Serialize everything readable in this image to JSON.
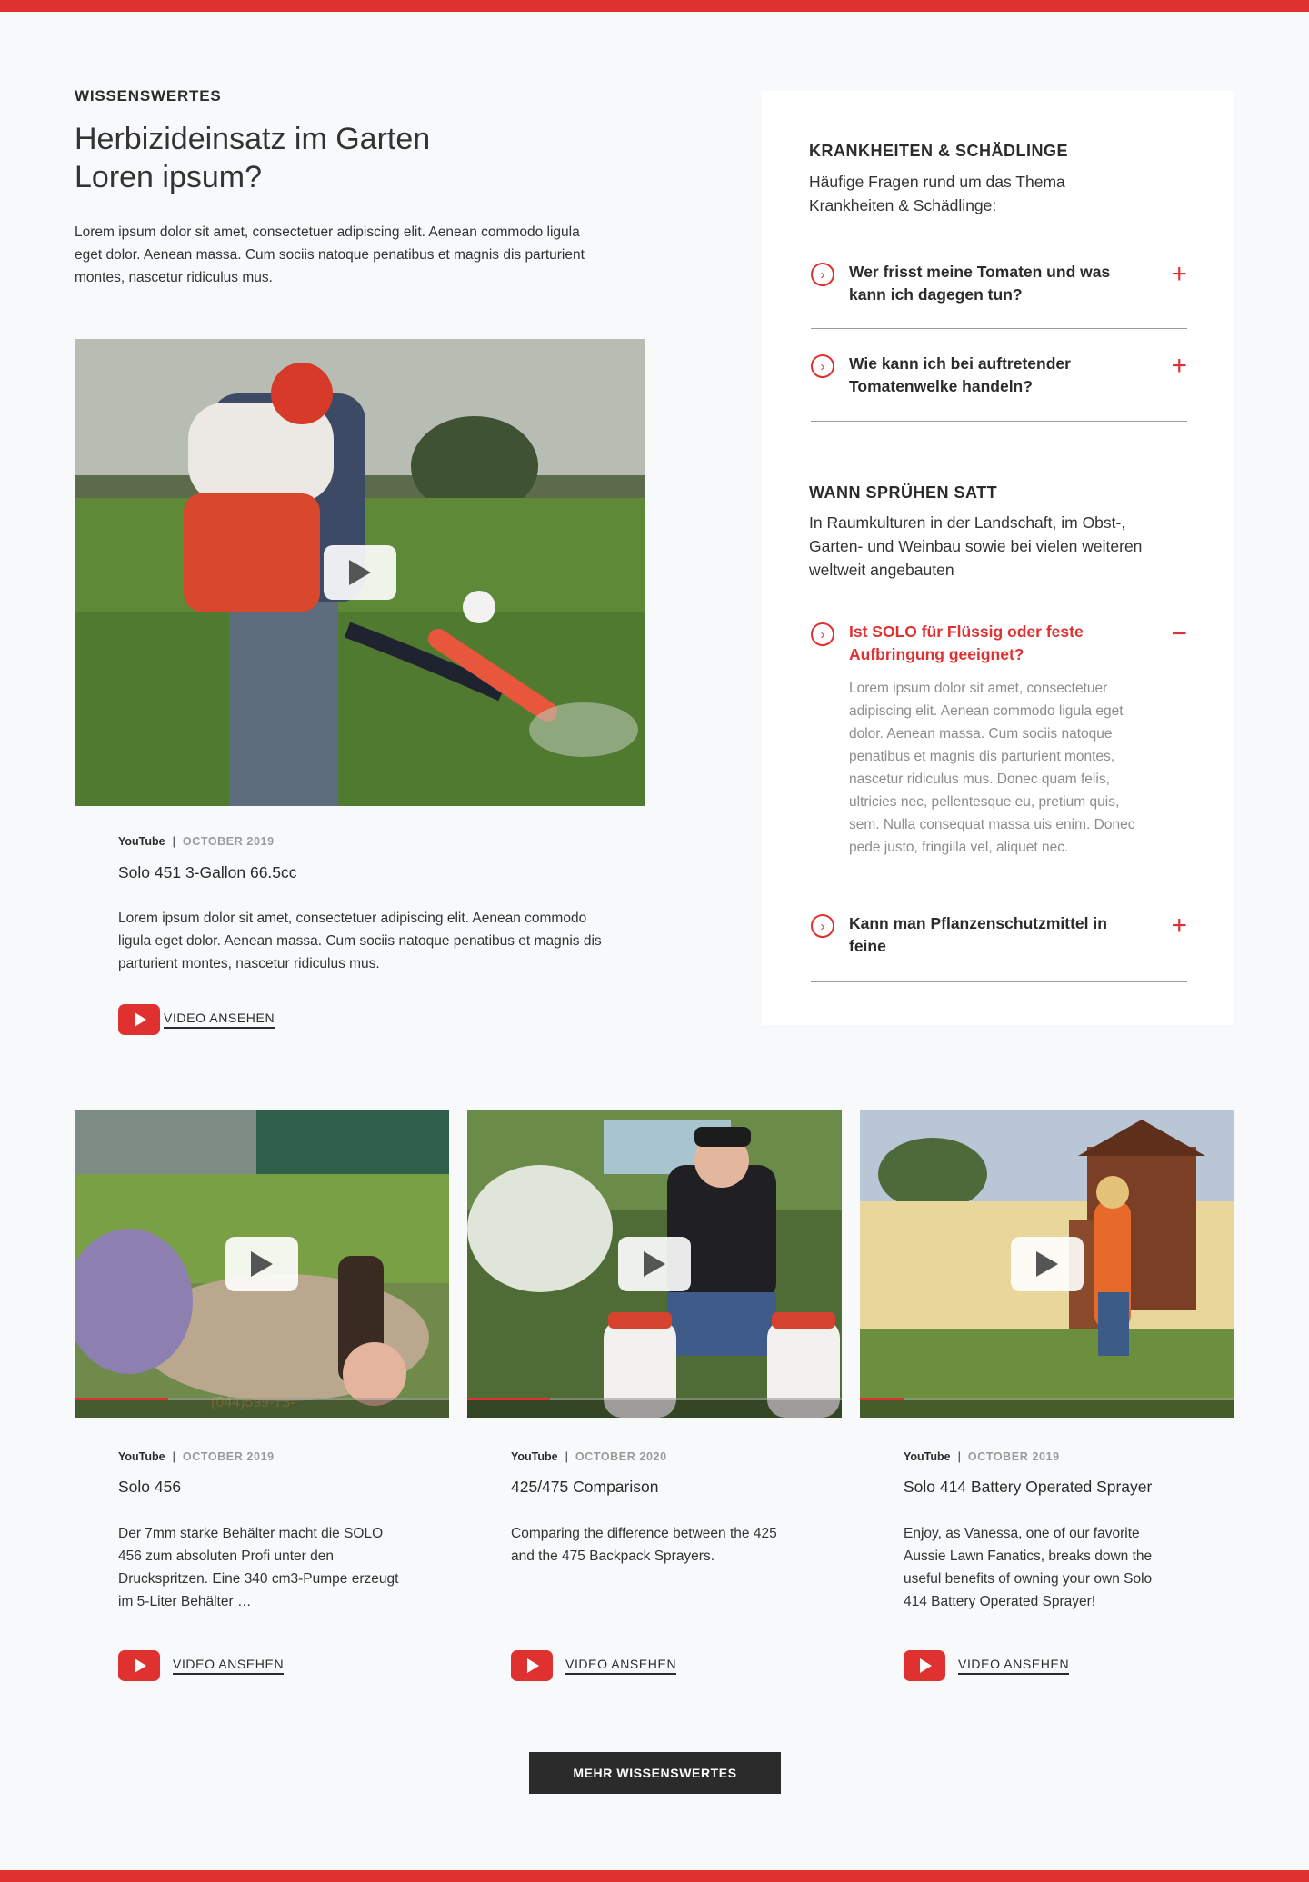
{
  "section": {
    "eyebrow": "WISSENSWERTES",
    "headline_line1": "Herbizideinsatz im Garten",
    "headline_line2": "Loren ipsum?",
    "intro": "Lorem ipsum dolor sit amet, consectetuer adipiscing elit. Aenean commodo ligula eget dolor. Aenean massa. Cum sociis natoque penatibus et magnis dis parturient montes, nascetur ridiculus mus."
  },
  "featured_video": {
    "source": "YouTube",
    "separator": "|",
    "date": "OCTOBER 2019",
    "title": "Solo 451 3-Gallon 66.5cc",
    "description": "Lorem ipsum dolor sit amet, consectetuer adipiscing elit. Aenean commodo ligula eget dolor. Aenean massa. Cum sociis natoque penatibus et magnis dis parturient montes, nascetur ridiculus mus.",
    "link_label": "VIDEO ANSEHEN"
  },
  "faq_panel": {
    "group1": {
      "title": "KRANKHEITEN & SCHÄDLINGE",
      "subtitle": "Häufige Fragen rund um das Thema Krankheiten & Schädlinge:",
      "items": [
        {
          "question": "Wer frisst meine Tomaten und was kann ich dagegen tun?",
          "toggle": "+"
        },
        {
          "question": "Wie kann ich bei auftretender Tomatenwelke handeln?",
          "toggle": "+"
        }
      ]
    },
    "group2": {
      "title": "WANN SPRÜHEN SATT",
      "subtitle": "In Raumkulturen in der Landschaft, im Obst-, Garten- und Weinbau sowie bei vielen weiteren weltweit angebauten",
      "items": [
        {
          "question": "Ist SOLO für Flüssig oder feste Aufbringung geeignet?",
          "toggle": "−",
          "answer": "Lorem ipsum dolor sit amet, consectetuer adipiscing elit. Aenean commodo ligula eget dolor. Aenean massa. Cum sociis natoque penatibus et magnis dis parturient montes, nascetur ridiculus mus. Donec quam felis, ultricies nec, pellentesque eu, pretium quis, sem. Nulla consequat massa uis enim. Donec pede justo, fringilla vel, aliquet nec."
        },
        {
          "question": "Kann man Pflanzenschutzmittel in feine",
          "toggle": "+"
        }
      ]
    },
    "icon": "chevron-right-circle-icon"
  },
  "videos": [
    {
      "source": "YouTube",
      "separator": "|",
      "date": "OCTOBER 2019",
      "title": "Solo 456",
      "description": "Der 7mm starke Behälter macht die SOLO 456 zum absoluten Profi unter den Druckspritzen. Eine 340 cm3-Pumpe erzeugt im 5-Liter Behälter …",
      "link_label": "VIDEO ANSEHEN",
      "overlay_text": "(044)599-73-"
    },
    {
      "source": "YouTube",
      "separator": "|",
      "date": "OCTOBER 2020",
      "title": "425/475 Comparison",
      "description": "Comparing the difference between the 425 and the 475 Backpack Sprayers.",
      "link_label": "VIDEO ANSEHEN"
    },
    {
      "source": "YouTube",
      "separator": "|",
      "date": "OCTOBER 2019",
      "title": "Solo 414 Battery Operated Sprayer",
      "description": "Enjoy, as Vanessa, one of our favorite Aussie Lawn Fanatics, breaks down the useful benefits of owning your own Solo 414 Battery Operated Sprayer!",
      "link_label": "VIDEO ANSEHEN"
    }
  ],
  "more_button": "MEHR WISSENSWERTES",
  "colors": {
    "accent": "#e03131",
    "dark": "#2b2b2b",
    "background": "#f8f9fb"
  }
}
